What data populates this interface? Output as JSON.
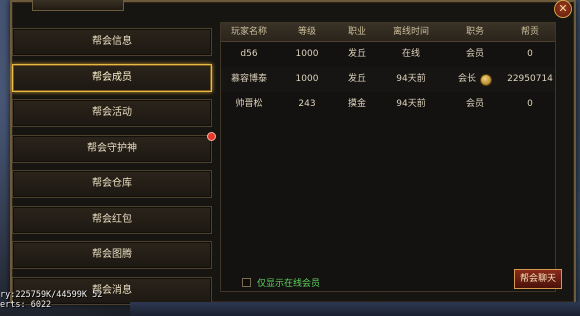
{
  "window": {
    "title": "",
    "close_label": "✕"
  },
  "sidebar": {
    "items": [
      {
        "label": "帮会信息",
        "active": false,
        "badge": false
      },
      {
        "label": "帮会成员",
        "active": true,
        "badge": false
      },
      {
        "label": "帮会活动",
        "active": false,
        "badge": false
      },
      {
        "label": "帮会守护神",
        "active": false,
        "badge": true
      },
      {
        "label": "帮会仓库",
        "active": false,
        "badge": false
      },
      {
        "label": "帮会红包",
        "active": false,
        "badge": false
      },
      {
        "label": "帮会图腾",
        "active": false,
        "badge": false
      },
      {
        "label": "帮会消息",
        "active": false,
        "badge": false
      }
    ]
  },
  "table": {
    "headers": [
      "玩家名称",
      "等级",
      "职业",
      "离线时间",
      "职务",
      "帮贡"
    ],
    "rows": [
      [
        "d56",
        "1000",
        "发丘",
        "在线",
        "会员",
        "0"
      ],
      [
        "慕容博泰",
        "1000",
        "发丘",
        "94天前",
        "会长",
        "22950714"
      ],
      [
        "帅晋松",
        "243",
        "摸金",
        "94天前",
        "会员",
        "0"
      ]
    ]
  },
  "footer": {
    "online_only_label": "仅显示在线会员",
    "chat_button_label": "帮会聊天"
  },
  "debug": {
    "line1": "ry:225759K/44599K 52",
    "line2": "erts:   6022"
  }
}
